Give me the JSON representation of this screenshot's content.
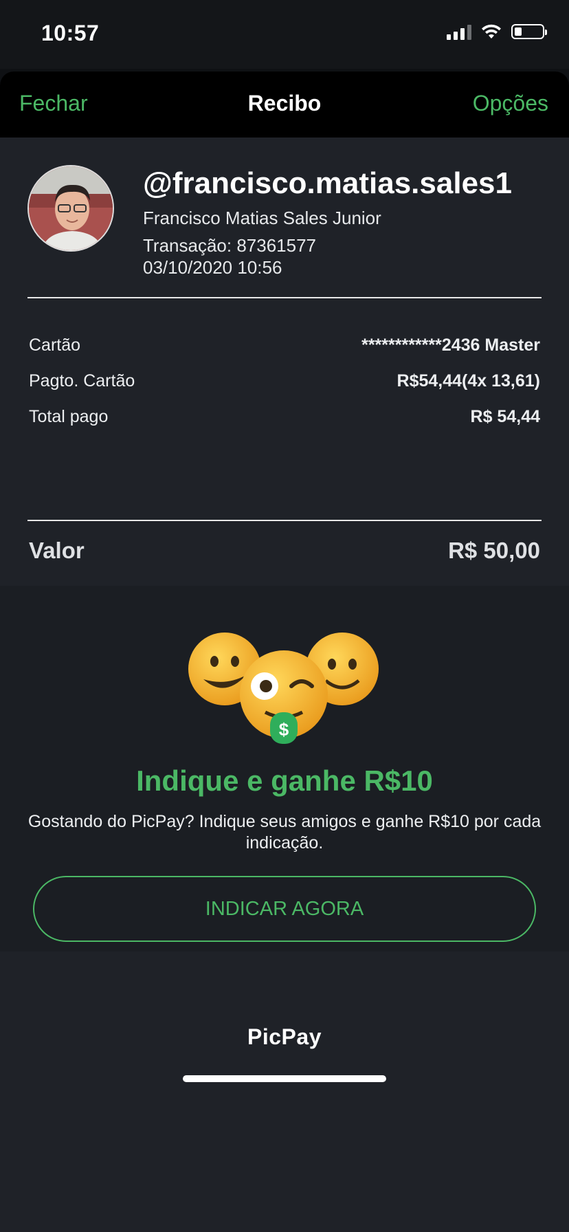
{
  "status": {
    "time": "10:57"
  },
  "nav": {
    "close": "Fechar",
    "title": "Recibo",
    "options": "Opções"
  },
  "profile": {
    "username": "@francisco.matias.sales1",
    "full_name": "Francisco Matias Sales Junior",
    "transaction": "Transação: 87361577",
    "date": "03/10/2020 10:56"
  },
  "details": [
    {
      "label": "Cartão",
      "value": "************2436 Master"
    },
    {
      "label": "Pagto. Cartão",
      "value": "R$54,44(4x 13,61)"
    },
    {
      "label": "Total pago",
      "value": "R$ 54,44"
    }
  ],
  "valor": {
    "label": "Valor",
    "value": "R$ 50,00"
  },
  "promo": {
    "title": "Indique e ganhe R$10",
    "text": "Gostando do PicPay? Indique seus amigos e ganhe R$10 por cada indicação.",
    "button": "INDICAR AGORA",
    "emoji_badge": "$"
  },
  "footer": {
    "logo": "PicPay"
  },
  "colors": {
    "accent": "#4bb865",
    "background": "#1f2228",
    "navbar": "#000000"
  },
  "icons": [
    "signal-icon",
    "wifi-icon",
    "battery-icon",
    "emoji-illustration"
  ]
}
